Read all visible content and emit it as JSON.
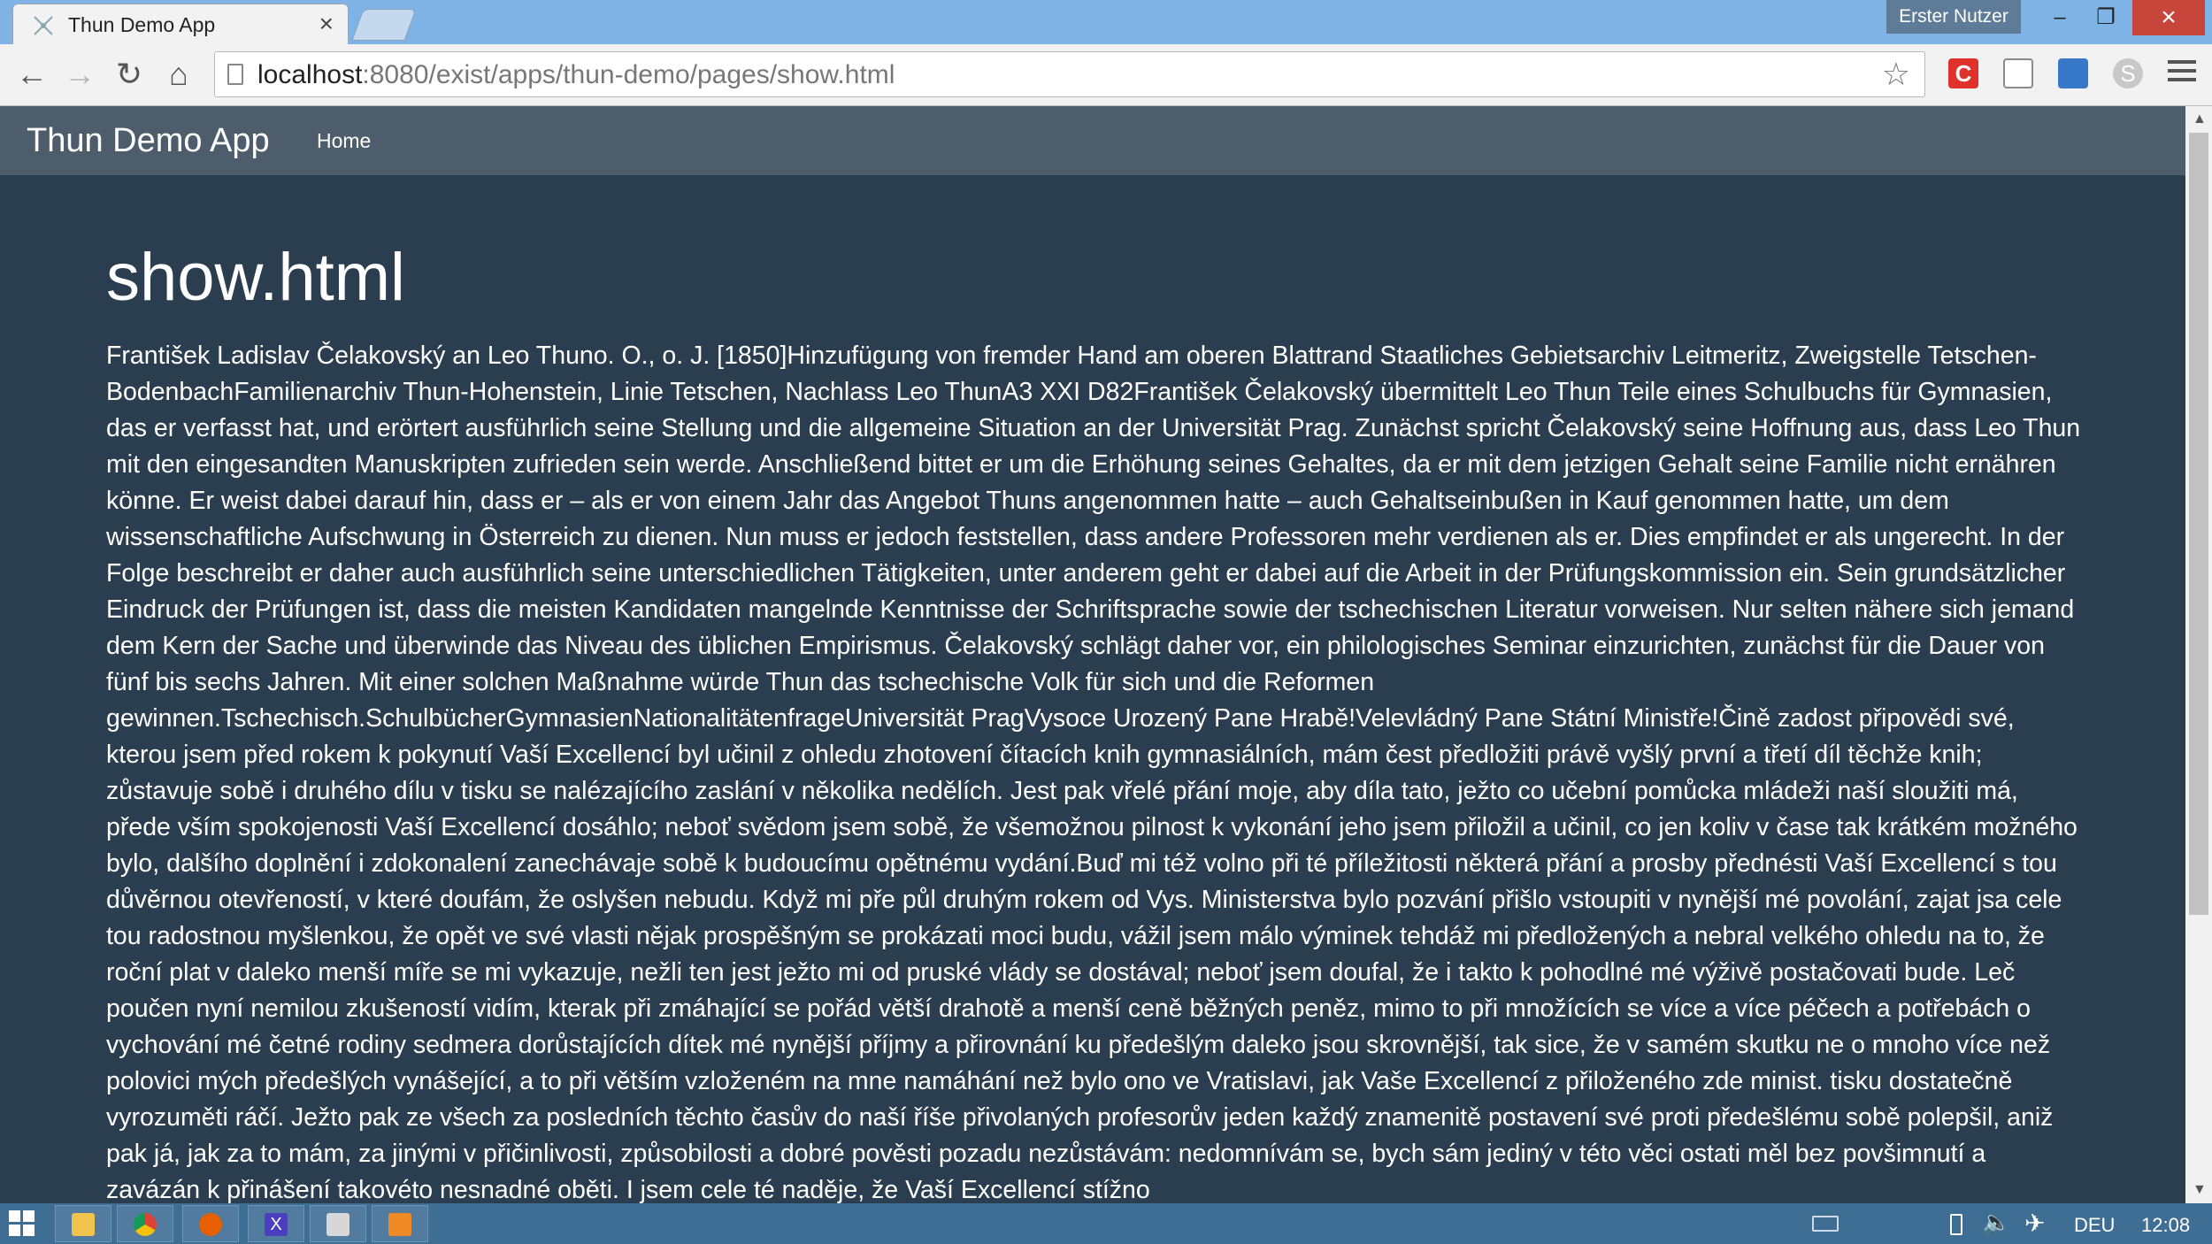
{
  "browser": {
    "tab_title": "Thun Demo App",
    "tab_close": "×",
    "profile_name": "Erster Nutzer",
    "url_host": "localhost",
    "url_rest": ":8080/exist/apps/thun-demo/pages/show.html",
    "window_controls": {
      "minimize": "–",
      "maximize": "❐",
      "close": "×"
    },
    "extensions": [
      "C",
      "",
      "",
      "S"
    ]
  },
  "app": {
    "brand": "Thun Demo App",
    "nav": {
      "home": "Home"
    }
  },
  "page": {
    "heading": "show.html",
    "text": "František Ladislav Čelakovský an Leo Thuno. O., o. J. [1850]Hinzufügung von fremder Hand am oberen Blattrand Staatliches Gebietsarchiv Leitmeritz, Zweigstelle Tetschen-BodenbachFamilienarchiv Thun-Hohenstein, Linie Tetschen, Nachlass Leo ThunA3 XXI D82František Čelakovský übermittelt Leo Thun Teile eines Schulbuchs für Gymnasien, das er verfasst hat, und erörtert ausführlich seine Stellung und die allgemeine Situation an der Universität Prag. Zunächst spricht Čelakovský seine Hoffnung aus, dass Leo Thun mit den eingesandten Manuskripten zufrieden sein werde. Anschließend bittet er um die Erhöhung seines Gehaltes, da er mit dem jetzigen Gehalt seine Familie nicht ernähren könne. Er weist dabei darauf hin, dass er – als er von einem Jahr das Angebot Thuns angenommen hatte – auch Gehaltseinbußen in Kauf genommen hatte, um dem wissenschaftliche Aufschwung in Österreich zu dienen. Nun muss er jedoch feststellen, dass andere Professoren mehr verdienen als er. Dies empfindet er als ungerecht. In der Folge beschreibt er daher auch ausführlich seine unterschiedlichen Tätigkeiten, unter anderem geht er dabei auf die Arbeit in der Prüfungskommission ein. Sein grundsätzlicher Eindruck der Prüfungen ist, dass die meisten Kandidaten mangelnde Kenntnisse der Schriftsprache sowie der tschechischen Literatur vorweisen. Nur selten nähere sich jemand dem Kern der Sache und überwinde das Niveau des üblichen Empirismus. Čelakovský schlägt daher vor, ein philologisches Seminar einzurichten, zunächst für die Dauer von fünf bis sechs Jahren. Mit einer solchen Maßnahme würde Thun das tschechische Volk für sich und die Reformen gewinnen.Tschechisch.SchulbücherGymnasienNationalitätenfrageUniversität PragVysoce Urozený Pane Hrabě!Velevládný Pane Státní Ministře!Čině zadost připovědi své, kterou jsem před rokem k pokynutí Vaší Excellencí byl učinil z ohledu zhotovení čítacích knih gymnasiálních, mám čest předložiti právě vyšlý první a třetí díl těchže knih; zůstavuje sobě i druhého dílu v tisku se nalézajícího zaslání v několika nedělích. Jest pak vřelé přání moje, aby díla tato, ježto co učební pomůcka mládeži naší sloužiti má, přede vším spokojenosti Vaší Excellencí dosáhlo; neboť svědom jsem sobě, že všemožnou pilnost k vykonání jeho jsem přiložil a učinil, co jen koliv v čase tak krátkém možného bylo, dalšího doplnění i zdokonalení zanechávaje sobě k budoucímu opětnému vydání.Buď mi též volno při té příležitosti některá přání a prosby přednésti Vaší Excellencí s tou důvěrnou otevřeností, v které doufám, že oslyšen nebudu. Když mi pře půl druhým rokem od Vys. Ministerstva bylo pozvání přišlo vstoupiti v nynější mé povolání, zajat jsa cele tou radostnou myšlenkou, že opět ve své vlasti nějak prospěšným se prokázati moci budu, vážil jsem málo výminek tehdáž mi předložených a nebral velkého ohledu na to, že roční plat v daleko menší míře se mi vykazuje, nežli ten jest ježto mi od pruské vlády se dostával; neboť jsem doufal, že i takto k pohodlné mé výživě postačovati bude. Leč poučen nyní nemilou zkušeností vidím, kterak při zmáhající se pořád větší drahotě a menší ceně běžných peněz, mimo to při množících se více a více péčech a potřebách o vychování mé četné rodiny sedmera dorůstajících dítek mé nynější příjmy a přirovnání ku předešlým daleko jsou skrovnější, tak sice, že v samém skutku ne o mnoho více než polovici mých předešlých vynášející, a to při větším vzloženém na mne namáhání než bylo ono ve Vratislavi, jak Vaše Excellencí z přiloženého zde minist. tisku dostatečně vyrozuměti ráčí. Ježto pak ze všech za posledních těchto časův do naší říše přivolaných profesorův jeden každý znamenitě postavení své proti předešlému sobě polepšil, aniž pak já, jak za to mám, za jinými v přičinlivosti, způsobilosti a dobré pověsti pozadu nezůstávám: nedomnívám se, bych sám jediný v této věci ostati měl bez povšimnutí a zavázán k přinášení takovéto nesnadné oběti. I jsem cele té naděje, že Vaší Excellencí stížno"
  },
  "taskbar": {
    "apps": [
      "explorer-icon",
      "chrome-icon",
      "firefox-icon",
      "xampp-icon",
      "tool-icon",
      "media-icon"
    ],
    "xampp_glyph": "X",
    "language": "DEU",
    "clock": "12:08"
  }
}
